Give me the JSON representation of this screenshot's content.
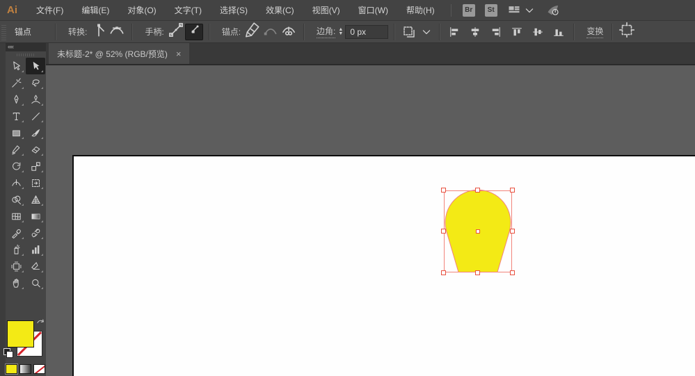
{
  "app": {
    "logo": "Ai"
  },
  "menubar": {
    "items": [
      "文件(F)",
      "编辑(E)",
      "对象(O)",
      "文字(T)",
      "选择(S)",
      "效果(C)",
      "视图(V)",
      "窗口(W)",
      "帮助(H)"
    ],
    "bridge_label": "Br",
    "style_label": "St",
    "right_icons": [
      "workspace-switcher-icon",
      "chevron-down-icon",
      "gpu-performance-icon"
    ]
  },
  "controlbar": {
    "title": "锚点",
    "convert_label": "转换:",
    "convert_icons": [
      "convert-corner-icon",
      "convert-smooth-icon"
    ],
    "handles_label": "手柄:",
    "handle_icons": [
      "show-handles-icon",
      "hide-handles-icon"
    ],
    "handles_active": "hide-handles-icon",
    "anchors_label": "锚点:",
    "anchor_icons": [
      "delete-anchor-pen-icon",
      "connect-path-icon",
      "cut-path-icon"
    ],
    "corner_label": "边角:",
    "corner_value": "0 px",
    "align_icons": [
      "align-left-icon",
      "align-hcenter-icon",
      "align-right-icon",
      "align-top-icon",
      "align-vcenter-icon",
      "align-bottom-icon"
    ],
    "align_to_icon": "align-to-artboard-icon",
    "transform_label": "变换",
    "isolate_icon": "isolate-selection-icon"
  },
  "tabbar": {
    "active_tab": "未标题-2* @ 52% (RGB/预览)",
    "close": "×"
  },
  "tools": [
    {
      "name": "selection-tool"
    },
    {
      "name": "direct-selection-tool",
      "active": true
    },
    {
      "name": "magic-wand-tool"
    },
    {
      "name": "lasso-tool"
    },
    {
      "name": "pen-tool"
    },
    {
      "name": "curvature-tool"
    },
    {
      "name": "type-tool"
    },
    {
      "name": "line-segment-tool"
    },
    {
      "name": "rectangle-tool"
    },
    {
      "name": "paintbrush-tool"
    },
    {
      "name": "shaper-tool"
    },
    {
      "name": "eraser-tool"
    },
    {
      "name": "rotate-tool"
    },
    {
      "name": "scale-tool"
    },
    {
      "name": "width-tool"
    },
    {
      "name": "free-transform-tool"
    },
    {
      "name": "shape-builder-tool"
    },
    {
      "name": "perspective-grid-tool"
    },
    {
      "name": "mesh-tool"
    },
    {
      "name": "gradient-tool"
    },
    {
      "name": "eyedropper-tool"
    },
    {
      "name": "blend-tool"
    },
    {
      "name": "symbol-sprayer-tool"
    },
    {
      "name": "column-graph-tool"
    },
    {
      "name": "artboard-tool"
    },
    {
      "name": "slice-tool"
    },
    {
      "name": "hand-tool"
    },
    {
      "name": "zoom-tool"
    }
  ],
  "swatch_controls": [
    "fill-swatch",
    "stroke-swatch",
    "swap-fill-stroke-icon",
    "default-fill-stroke-icon",
    "color-mode-button",
    "gradient-mode-button",
    "none-mode-button"
  ],
  "colors": {
    "fill_yellow": "#f3ea15",
    "selection_red": "#e8503f",
    "selection_line": "#f2837a",
    "artboard_white": "#fefefe",
    "pasteboard_gray": "#5d5d5d"
  }
}
